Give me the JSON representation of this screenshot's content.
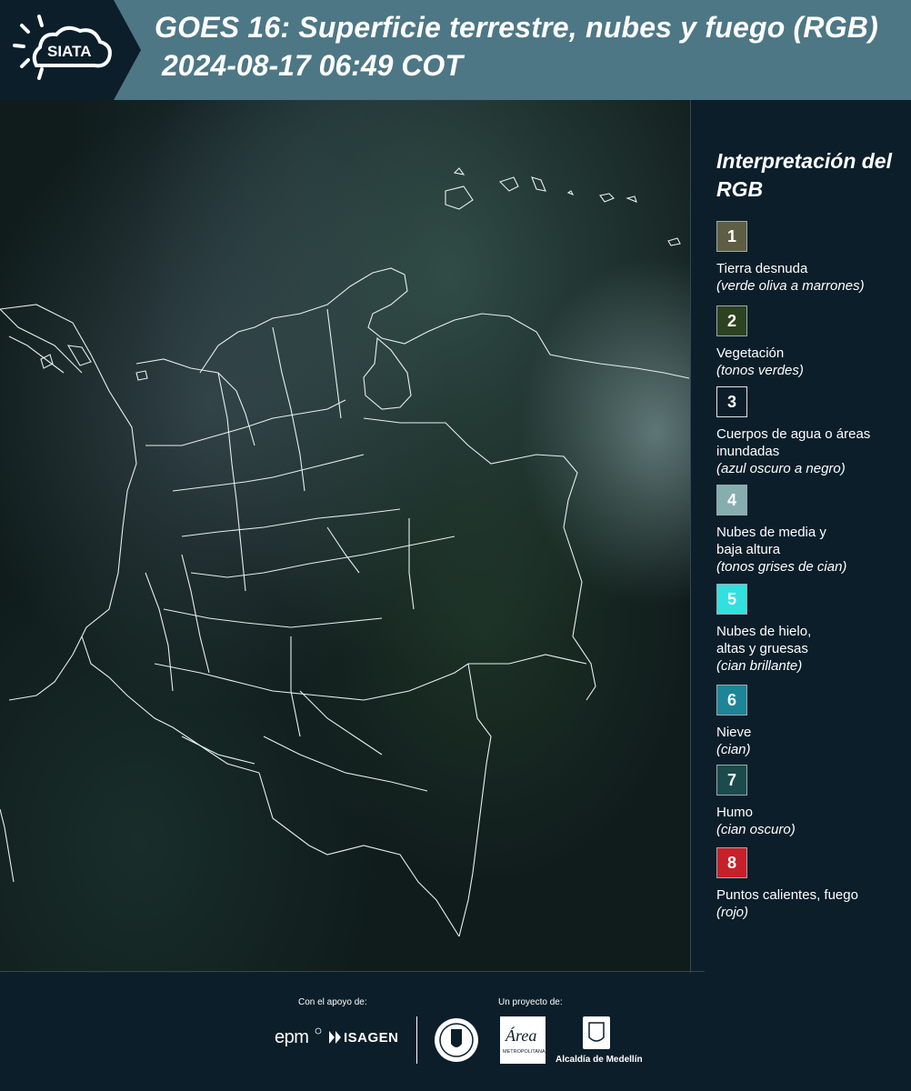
{
  "header": {
    "logo_text": "SIATA",
    "title_line1": "GOES 16: Superficie terrestre, nubes y fuego (RGB)",
    "title_line2": "2024-08-17 06:49 COT"
  },
  "legend": {
    "title": "Interpretación del RGB",
    "items": [
      {
        "num": "1",
        "label": "Tierra desnuda",
        "sub": "(verde oliva a marrones)",
        "color": "#5e5e44"
      },
      {
        "num": "2",
        "label": "Vegetación",
        "sub": "(tonos verdes)",
        "color": "#2d4221"
      },
      {
        "num": "3",
        "label": "Cuerpos de agua o áreas inundadas",
        "sub": "(azul oscuro a negro)",
        "color": "#0b1e2a"
      },
      {
        "num": "4",
        "label": "Nubes de media y baja altura",
        "sub": "(tonos grises de cian)",
        "color": "#86aeaf"
      },
      {
        "num": "5",
        "label": "Nubes de hielo, altas y gruesas",
        "sub": "(cian brillante)",
        "color": "#33e0e0"
      },
      {
        "num": "6",
        "label": "Nieve",
        "sub": "(cian)",
        "color": "#1e8497"
      },
      {
        "num": "7",
        "label": "Humo",
        "sub": "(cian oscuro)",
        "color": "#1b4b4c"
      },
      {
        "num": "8",
        "label": "Puntos calientes, fuego",
        "sub": "(rojo)",
        "color": "#c6202a"
      }
    ]
  },
  "footer": {
    "support_label": "Con el apoyo de:",
    "project_label": "Un proyecto de:",
    "sponsor_epm": "epm",
    "sponsor_isagen": "ISAGEN",
    "area_logo_text": "Área",
    "area_logo_sub": "METROPOLITANA",
    "alcaldia": "Alcaldía de Medellín"
  },
  "colors": {
    "header_bg": "#4d7785",
    "page_bg": "#0b1e2a",
    "map_bg": "#0e1a1a"
  }
}
